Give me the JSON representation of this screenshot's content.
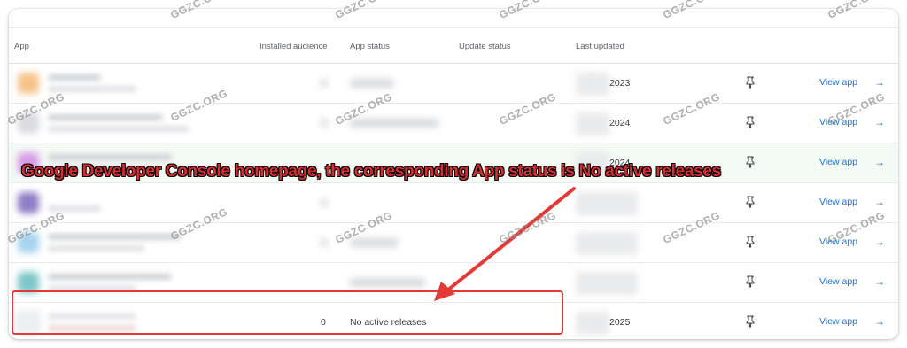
{
  "table": {
    "headers": {
      "app": "App",
      "installed_audience": "Installed audience",
      "app_status": "App status",
      "update_status": "Update status",
      "last_updated": "Last updated"
    },
    "rows": [
      {
        "year": "2023",
        "view": "View app"
      },
      {
        "year": "2024",
        "view": "View app"
      },
      {
        "year": "2024",
        "view": "View app"
      },
      {
        "year": "",
        "view": "View app"
      },
      {
        "year": "",
        "view": "View app"
      },
      {
        "year": "",
        "view": "View app"
      },
      {
        "audience": "0",
        "status": "No active releases",
        "year": "2025",
        "view": "View app"
      }
    ]
  },
  "annotation": {
    "text": "Google Developer Console homepage, the corresponding App status is No active releases"
  },
  "watermark": "GGZC.ORG",
  "colors": {
    "link": "#1a73e8",
    "annotation": "#d32f2f",
    "highlight_border": "#e53935",
    "row_highlight": "#f4faf4"
  },
  "icons": {
    "pin": "pin-icon",
    "arrow": "arrow-right-icon"
  }
}
